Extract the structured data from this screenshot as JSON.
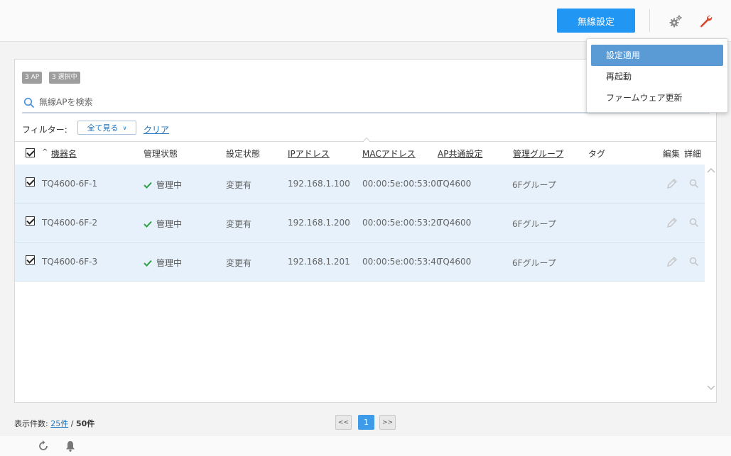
{
  "topbar": {
    "wireless_settings_button": "無線設定",
    "gears_icon": "gears-icon",
    "wrench_icon": "wrench-icon"
  },
  "dropdown": {
    "items": [
      "設定適用",
      "再起動",
      "ファームウェア更新"
    ],
    "active_index": 0
  },
  "panel": {
    "badges": {
      "ap_count": "3 AP",
      "selected": "3 選択中"
    },
    "search": {
      "placeholder": "無線APを検索"
    },
    "filter": {
      "label": "フィルター:",
      "selected": "全て見る",
      "clear": "クリア"
    }
  },
  "table": {
    "headers": {
      "name": "機器名",
      "sort_indicator": "^",
      "admin_status": "管理状態",
      "config_status": "設定状態",
      "ip": "IPアドレス",
      "mac": "MACアドレス",
      "ap_common": "AP共通設定",
      "group": "管理グループ",
      "tag": "タグ",
      "edit": "編集",
      "detail": "詳細"
    },
    "rows": [
      {
        "name": "TQ4600-6F-1",
        "admin_status": "管理中",
        "config_status": "変更有",
        "ip": "192.168.1.100",
        "mac": "00:00:5e:00:53:00",
        "ap_common": "TQ4600",
        "group": "6Fグループ",
        "tag": ""
      },
      {
        "name": "TQ4600-6F-2",
        "admin_status": "管理中",
        "config_status": "変更有",
        "ip": "192.168.1.200",
        "mac": "00:00:5e:00:53:20",
        "ap_common": "TQ4600",
        "group": "6Fグループ",
        "tag": ""
      },
      {
        "name": "TQ4600-6F-3",
        "admin_status": "管理中",
        "config_status": "変更有",
        "ip": "192.168.1.201",
        "mac": "00:00:5e:00:53:40",
        "ap_common": "TQ4600",
        "group": "6Fグループ",
        "tag": ""
      }
    ]
  },
  "footer": {
    "count_label": "表示件数:",
    "per_page": "25件",
    "separator": "/",
    "total": "50件",
    "pager": {
      "prev": "<<",
      "current": "1",
      "next": ">>"
    }
  },
  "colors": {
    "primary": "#2196f3",
    "accent_red": "#d9452b",
    "check_green": "#2ea043",
    "row_bg": "#e6f1fb"
  }
}
